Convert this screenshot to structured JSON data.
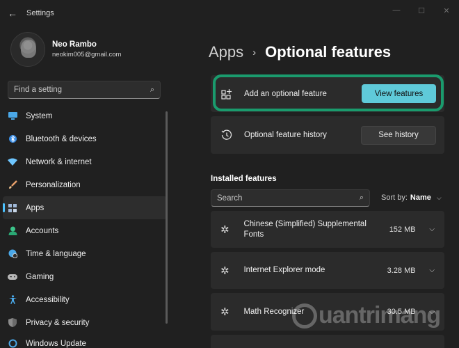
{
  "window": {
    "title": "Settings",
    "controls": {
      "minimize": "—",
      "maximize": "☐",
      "close": "✕"
    }
  },
  "profile": {
    "name": "Neo Rambo",
    "email": "neokim005@gmail.com"
  },
  "find": {
    "placeholder": "Find a setting"
  },
  "nav": {
    "items": [
      {
        "label": "System",
        "icon": "monitor-icon",
        "color": "#4aa8e8"
      },
      {
        "label": "Bluetooth & devices",
        "icon": "bluetooth-icon",
        "color": "#3a8ee6"
      },
      {
        "label": "Network & internet",
        "icon": "wifi-icon",
        "color": "#6ec6ff"
      },
      {
        "label": "Personalization",
        "icon": "brush-icon",
        "color": "#e8a06a"
      },
      {
        "label": "Apps",
        "icon": "apps-icon",
        "color": "#9fb8d8",
        "active": true
      },
      {
        "label": "Accounts",
        "icon": "person-icon",
        "color": "#3cc48a"
      },
      {
        "label": "Time & language",
        "icon": "globe-clock-icon",
        "color": "#4aa8e8"
      },
      {
        "label": "Gaming",
        "icon": "gamepad-icon",
        "color": "#b8b8b8"
      },
      {
        "label": "Accessibility",
        "icon": "accessibility-icon",
        "color": "#4aa8e8"
      },
      {
        "label": "Privacy & security",
        "icon": "shield-icon",
        "color": "#8c8c8c"
      },
      {
        "label": "Windows Update",
        "icon": "update-icon",
        "color": "#4aa8e8"
      }
    ]
  },
  "breadcrumb": {
    "parent": "Apps",
    "separator": "›",
    "current": "Optional features"
  },
  "cards": {
    "add": {
      "label": "Add an optional feature",
      "button": "View features"
    },
    "history": {
      "label": "Optional feature history",
      "button": "See history"
    }
  },
  "installed": {
    "title": "Installed features",
    "search_placeholder": "Search",
    "sort_label": "Sort by:",
    "sort_value": "Name",
    "features": [
      {
        "name": "Chinese (Simplified) Supplemental Fonts",
        "size": "152 MB"
      },
      {
        "name": "Internet Explorer mode",
        "size": "3.28 MB"
      },
      {
        "name": "Math Recognizer",
        "size": "30.5 MB"
      }
    ]
  },
  "watermark": {
    "text": "uantrimang"
  },
  "colors": {
    "accent": "#5fcad9",
    "highlight": "#1a9b6d",
    "nav_indicator": "#4cc2ff"
  }
}
